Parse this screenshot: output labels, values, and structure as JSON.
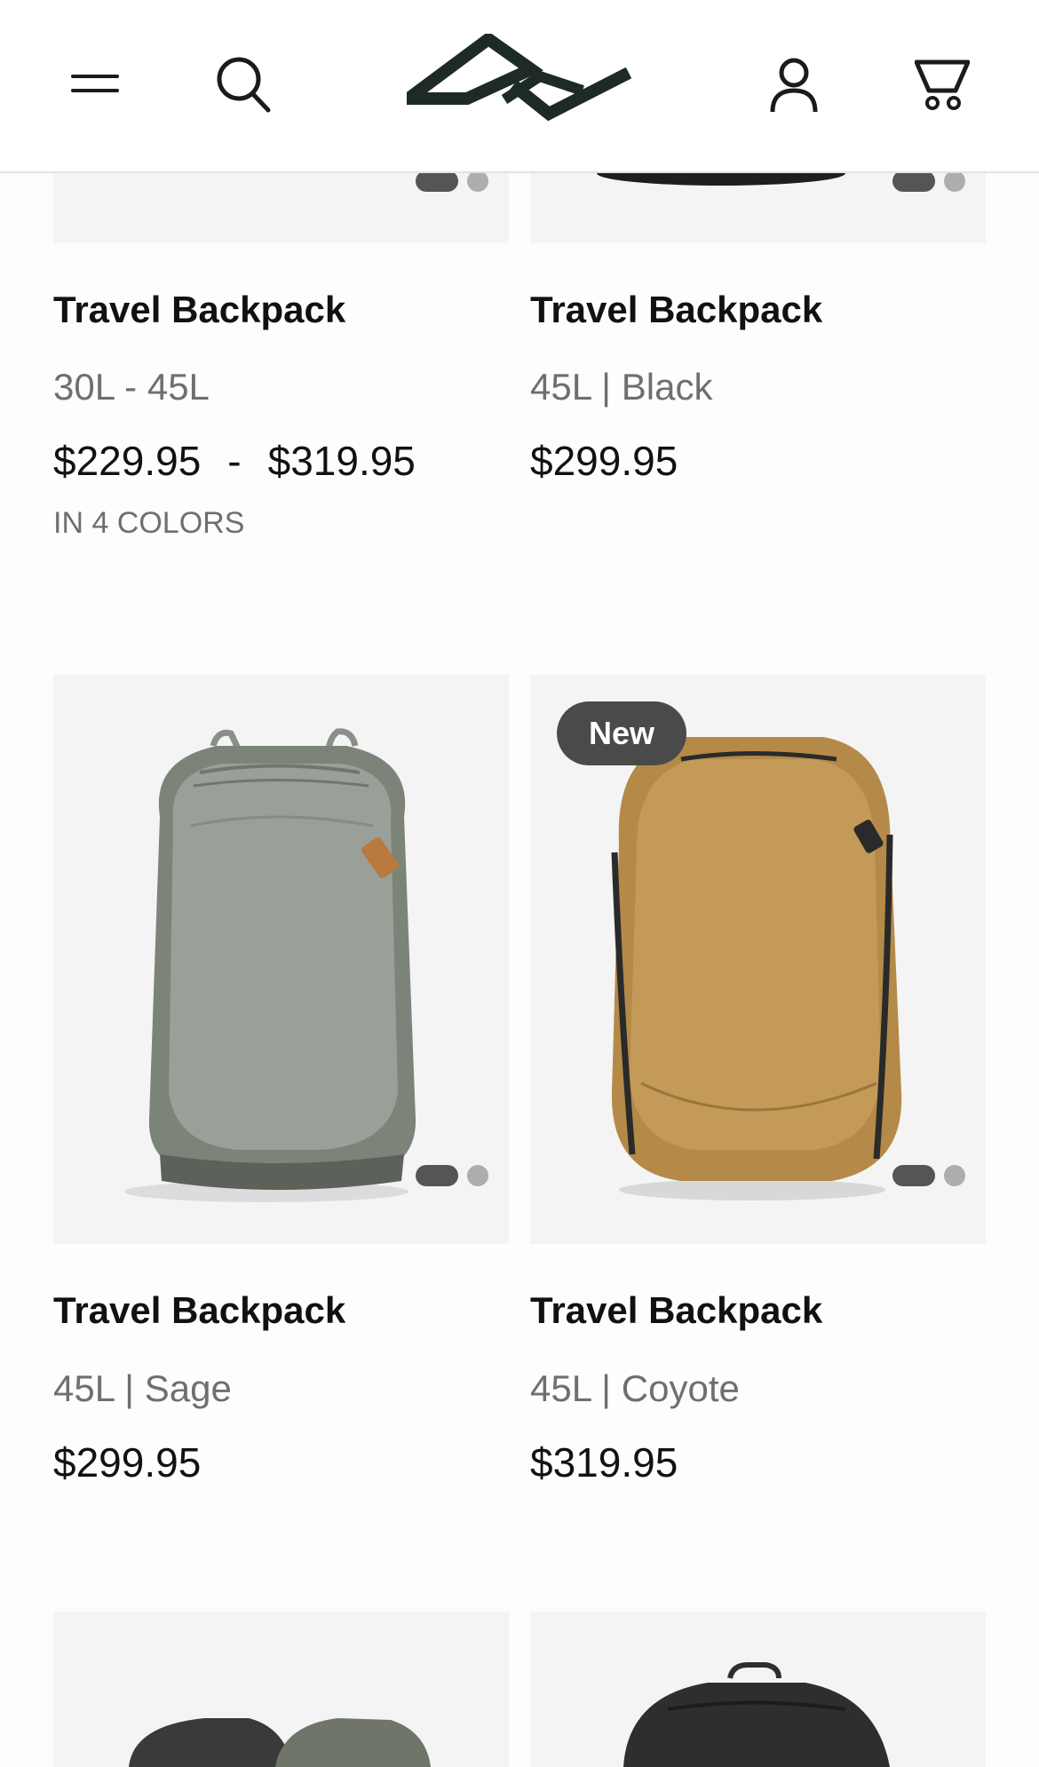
{
  "header": {
    "menu_icon": "hamburger-icon",
    "search_icon": "search-icon",
    "logo": "peak-design-logo",
    "account_icon": "user-icon",
    "cart_icon": "cart-icon"
  },
  "products": [
    {
      "name": "Travel Backpack",
      "variant": "30L - 45L",
      "price_from": "$229.95",
      "price_to": "$319.95",
      "price_separator": "-",
      "colors_note": "IN 4 COLORS",
      "slide_count": 2,
      "active_slide": 1
    },
    {
      "name": "Travel Backpack",
      "variant": "45L | Black",
      "price": "$299.95",
      "slide_count": 2,
      "active_slide": 1
    },
    {
      "name": "Travel Backpack",
      "variant": "45L | Sage",
      "price": "$299.95",
      "image": "sage backpack",
      "slide_count": 2,
      "active_slide": 1
    },
    {
      "name": "Travel Backpack",
      "variant": "45L | Coyote",
      "price": "$319.95",
      "badge": "New",
      "image": "coyote backpack",
      "slide_count": 2,
      "active_slide": 1
    }
  ],
  "colors": {
    "sage": "#8c918a",
    "coyote": "#b38a4a",
    "badge_bg": "#4a4a4a",
    "tile_bg": "#f4f4f4"
  }
}
